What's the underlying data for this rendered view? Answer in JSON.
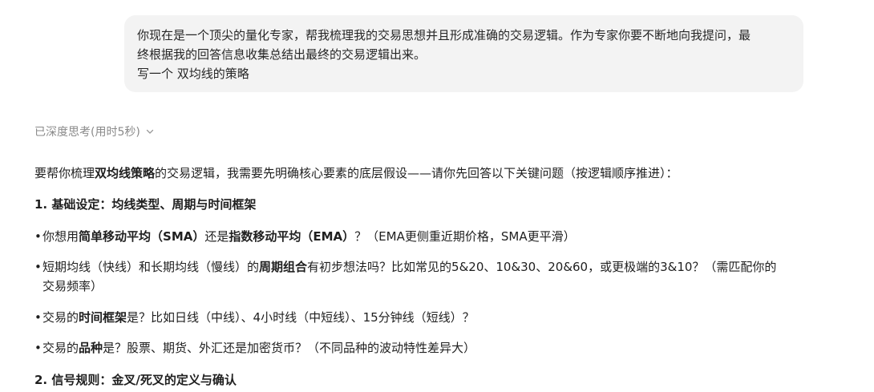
{
  "user_message": {
    "line1": "你现在是一个顶尖的量化专家，帮我梳理我的交易思想并且形成准确的交易逻辑。作为专家你要不断地向我提问，最",
    "line2": "终根据我的回答信息收集总结出最终的交易逻辑出来。",
    "line3": "写一个 双均线的策略"
  },
  "thinking": {
    "label": "已深度思考(用时5秒)",
    "toggle_icon": "chevron-down-icon"
  },
  "answer": {
    "intro_pre": "要帮你梳理",
    "intro_bold": "双均线策略",
    "intro_post": "的交易逻辑，我需要先明确核心要素的底层假设——请你先回答以下关键问题（按逻辑顺序推进）：",
    "section1_title": "1. 基础设定：均线类型、周期与时间框架",
    "bullets": [
      {
        "t1": "你想用",
        "b1": "简单移动平均（SMA）",
        "t2": "还是",
        "b2": "指数移动平均（EMA）",
        "t3": "？（EMA更侧重近期价格，SMA更平滑）"
      },
      {
        "t1": "短期均线（快线）和长期均线（慢线）的",
        "b1": "周期组合",
        "t2": "有初步想法吗？比如常见的5&20、10&30、20&60，或更极端的3&10？（需匹配你的",
        "t3": "交易频率）"
      },
      {
        "t1": "交易的",
        "b1": "时间框架",
        "t2": "是？比如日线（中线）、4小时线（中短线）、15分钟线（短线）？"
      },
      {
        "t1": "交易的",
        "b1": "品种",
        "t2": "是？股票、期货、外汇还是加密货币？（不同品种的波动特性差异大）"
      }
    ],
    "section2_title": "2. 信号规则：金叉/死叉的定义与确认"
  }
}
